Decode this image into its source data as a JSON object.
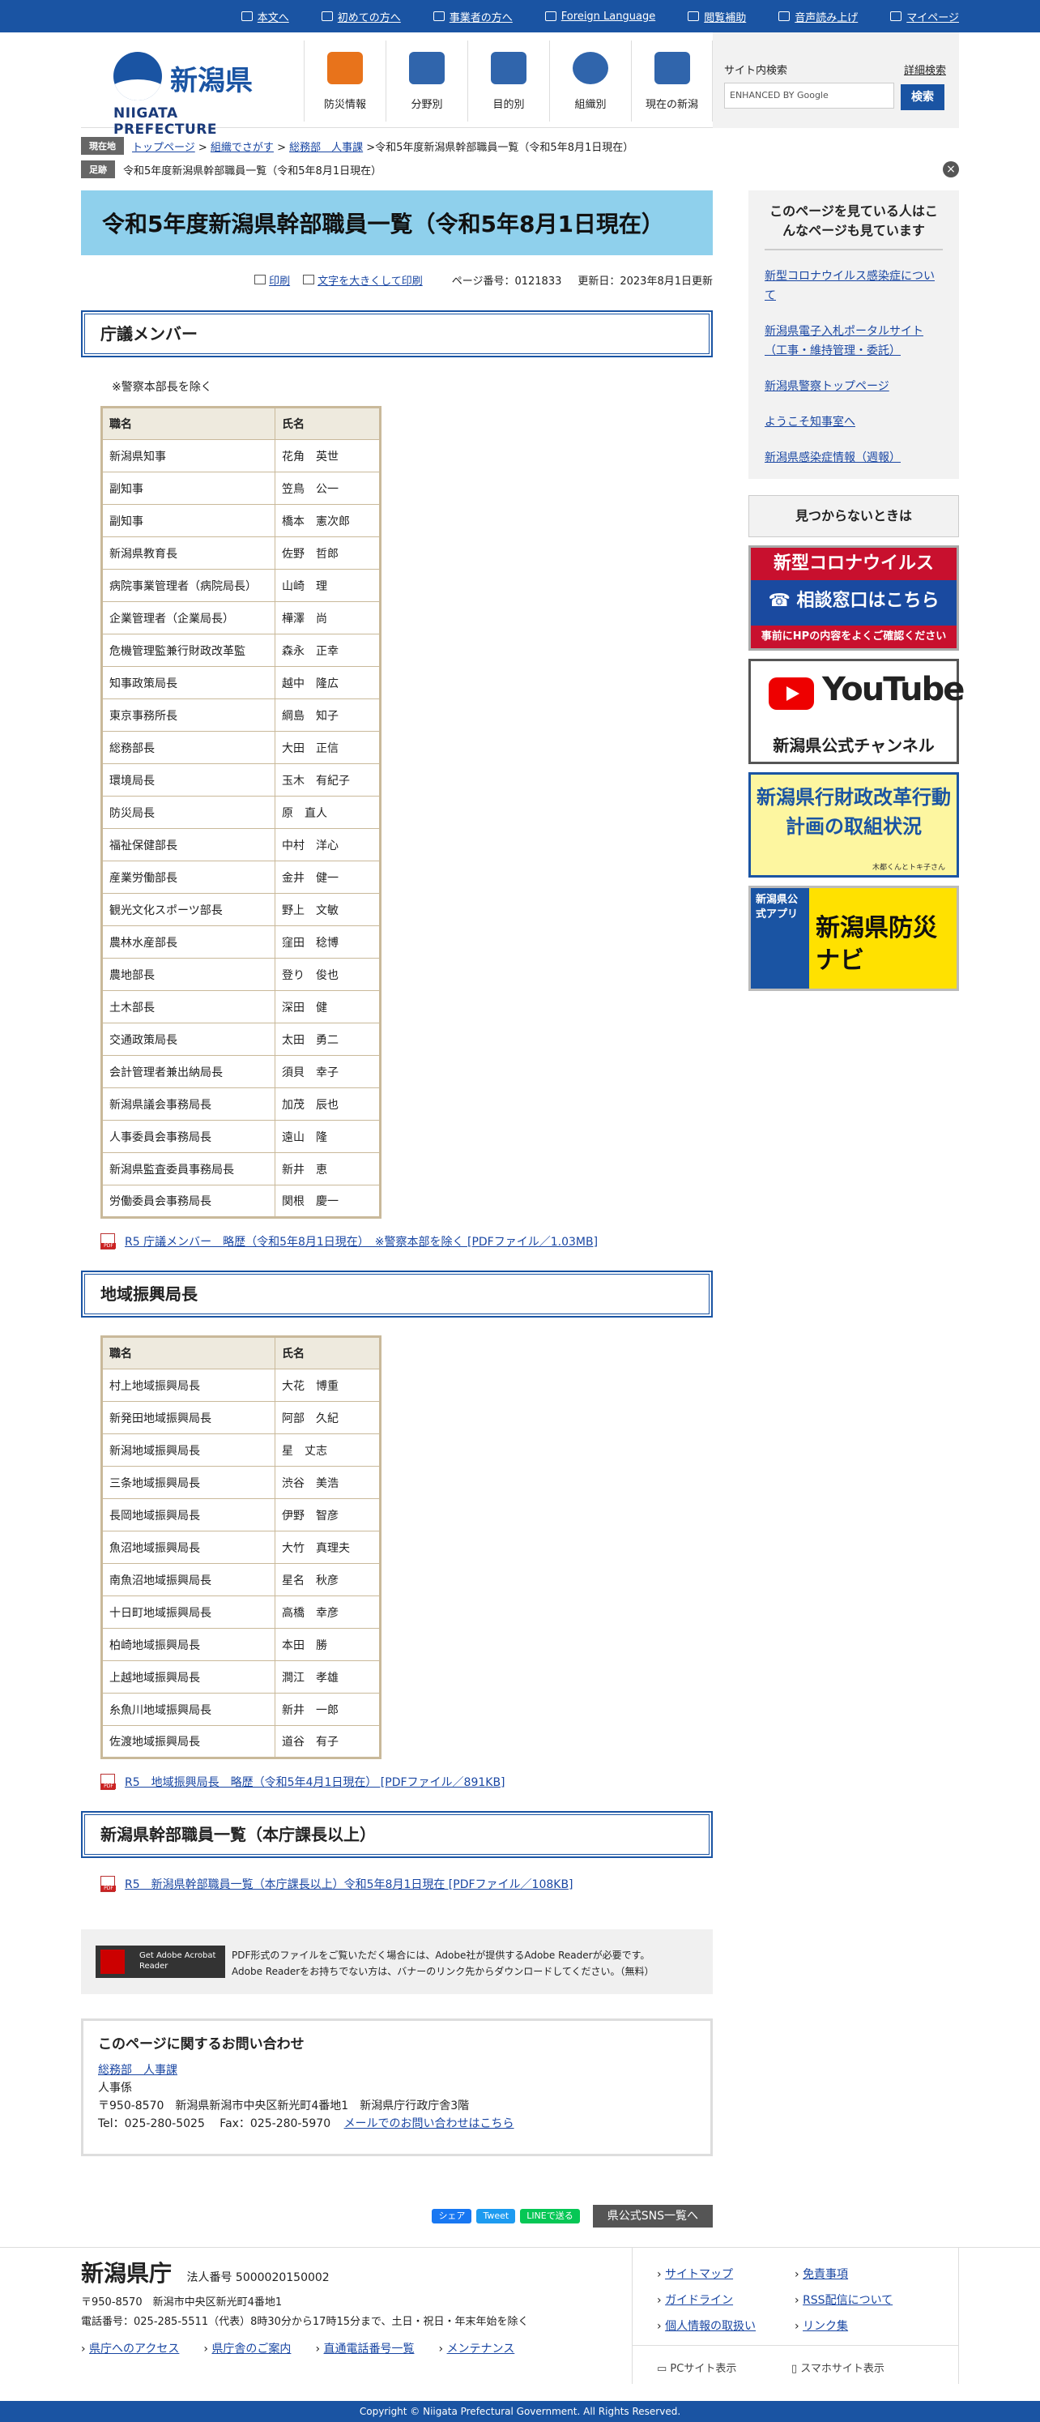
{
  "util_links": [
    "本文へ",
    "初めての方へ",
    "事業者の方へ",
    "Foreign Language",
    "閲覧補助",
    "音声読み上げ",
    "マイページ"
  ],
  "logo": {
    "jp": "新潟県",
    "en": "NIIGATA PREFECTURE"
  },
  "gnav": [
    "防災情報",
    "分野別",
    "目的別",
    "組織別",
    "現在の新潟"
  ],
  "search": {
    "label": "サイト内検索",
    "advanced": "詳細検索",
    "placeholder": "ENHANCED BY Google",
    "button": "検索"
  },
  "crumb": {
    "tag": "現在地",
    "items": [
      "トップページ",
      "組織でさがす",
      "総務部　人事課"
    ],
    "current": "令和5年度新潟県幹部職員一覧（令和5年8月1日現在）"
  },
  "fixed": {
    "tag": "足跡",
    "text": "令和5年度新潟県幹部職員一覧（令和5年8月1日現在）"
  },
  "page_title": "令和5年度新潟県幹部職員一覧（令和5年8月1日現在）",
  "tools": {
    "print": "印刷",
    "bigtext": "文字を大きくして印刷",
    "page_no": "ページ番号：0121833",
    "updated": "更新日：2023年8月1日更新"
  },
  "sec1": {
    "title": "庁議メンバー",
    "note": "※警察本部長を除く",
    "head": [
      "職名",
      "氏名"
    ],
    "rows": [
      [
        "新潟県知事",
        "花角　英世"
      ],
      [
        "副知事",
        "笠鳥　公一"
      ],
      [
        "副知事",
        "橋本　憲次郎"
      ],
      [
        "新潟県教育長",
        "佐野　哲郎"
      ],
      [
        "病院事業管理者（病院局長）",
        "山崎　理"
      ],
      [
        "企業管理者（企業局長）",
        "樺澤　尚"
      ],
      [
        "危機管理監兼行財政改革監",
        "森永　正幸"
      ],
      [
        "知事政策局長",
        "越中　隆広"
      ],
      [
        "東京事務所長",
        "綱島　知子"
      ],
      [
        "総務部長",
        "大田　正信"
      ],
      [
        "環境局長",
        "玉木　有紀子"
      ],
      [
        "防災局長",
        "原　直人"
      ],
      [
        "福祉保健部長",
        "中村　洋心"
      ],
      [
        "産業労働部長",
        "金井　健一"
      ],
      [
        "観光文化スポーツ部長",
        "野上　文敏"
      ],
      [
        "農林水産部長",
        "窪田　稔博"
      ],
      [
        "農地部長",
        "登り　俊也"
      ],
      [
        "土木部長",
        "深田　健"
      ],
      [
        "交通政策局長",
        "太田　勇二"
      ],
      [
        "会計管理者兼出納局長",
        "須貝　幸子"
      ],
      [
        "新潟県議会事務局長",
        "加茂　辰也"
      ],
      [
        "人事委員会事務局長",
        "遠山　隆"
      ],
      [
        "新潟県監査委員事務局長",
        "新井　恵"
      ],
      [
        "労働委員会事務局長",
        "関根　慶一"
      ]
    ],
    "pdf": "R5 庁議メンバー　略歴（令和5年8月1日現在）　※警察本部を除く [PDFファイル／1.03MB]"
  },
  "sec2": {
    "title": "地域振興局長",
    "head": [
      "職名",
      "氏名"
    ],
    "rows": [
      [
        "村上地域振興局長",
        "大花　博重"
      ],
      [
        "新発田地域振興局長",
        "阿部　久紀"
      ],
      [
        "新潟地域振興局長",
        "星　丈志"
      ],
      [
        "三条地域振興局長",
        "渋谷　美浩"
      ],
      [
        "長岡地域振興局長",
        "伊野　智彦"
      ],
      [
        "魚沼地域振興局長",
        "大竹　真理夫"
      ],
      [
        "南魚沼地域振興局長",
        "星名　秋彦"
      ],
      [
        "十日町地域振興局長",
        "高橋　幸彦"
      ],
      [
        "柏崎地域振興局長",
        "本田　勝"
      ],
      [
        "上越地域振興局長",
        "澗江　孝雄"
      ],
      [
        "糸魚川地域振興局長",
        "新井　一郎"
      ],
      [
        "佐渡地域振興局長",
        "道谷　有子"
      ]
    ],
    "pdf": "R5　地域振興局長　略歴（令和5年4月1日現在） [PDFファイル／891KB]"
  },
  "sec3": {
    "title": "新潟県幹部職員一覧（本庁課長以上）",
    "pdf": "R5　新潟県幹部職員一覧（本庁課長以上）令和5年8月1日現在 [PDFファイル／108KB]"
  },
  "adobe": {
    "badge": "Get Adobe Acrobat Reader",
    "line1": "PDF形式のファイルをご覧いただく場合には、Adobe社が提供するAdobe Readerが必要です。",
    "line2": "Adobe Readerをお持ちでない方は、バナーのリンク先からダウンロードしてください。（無料）"
  },
  "contact": {
    "title": "このページに関するお問い合わせ",
    "dept": "総務部　人事課",
    "section": "人事係",
    "address": "〒950-8570　新潟県新潟市中央区新光町4番地1　新潟県庁行政庁舎3階",
    "tel": "Tel：025-280-5025　 Fax：025-280-5970",
    "mail": "メールでのお問い合わせはこちら"
  },
  "sns": {
    "fb": "シェア",
    "tw": "Tweet",
    "line": "LINEで送る",
    "list": "県公式SNS一覧へ"
  },
  "side": {
    "related_title": "このページを見ている人はこんなページも見ています",
    "related": [
      "新型コロナウイルス感染症について",
      "新潟県電子入札ポータルサイト（工事・維持管理・委託）",
      "新潟県警察トップページ",
      "ようこそ知事室へ",
      "新潟県感染症情報（週報）"
    ],
    "notfound": "見つからないときは",
    "b1": {
      "t": "新型コロナウイルス",
      "m": "☎ 相談窓口はこちら",
      "b": "事前にHPの内容をよくご確認ください"
    },
    "b2": {
      "t": "YouTube",
      "s": "新潟県公式チャンネル"
    },
    "b3": {
      "t": "新潟県行財政改革行動計画の取組状況",
      "s": "木都くんとトキ子さん"
    },
    "b4": {
      "l": "新潟県公式アプリ",
      "r": "新潟県防災ナビ"
    }
  },
  "footer": {
    "name": "新潟県庁",
    "corp": "法人番号 5000020150002",
    "addr": "〒950-8570　新潟市中央区新光町4番地1",
    "tel": "電話番号：025-285-5511（代表）8時30分から17時15分まで、土日・祝日・年末年始を除く",
    "links": [
      "県庁へのアクセス",
      "県庁舎のご案内",
      "直通電話番号一覧",
      "メンテナンス"
    ],
    "rlinks": [
      "サイトマップ",
      "免責事項",
      "ガイドライン",
      "RSS配信について",
      "個人情報の取扱い",
      "リンク集"
    ],
    "pc": "PCサイト表示",
    "sp": "スマホサイト表示"
  },
  "copyright": "Copyright © Niigata Prefectural Government. All Rights Reserved."
}
